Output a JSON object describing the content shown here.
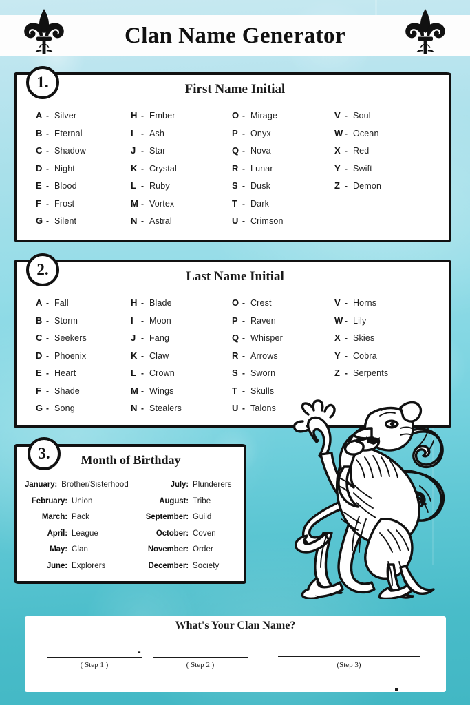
{
  "header": {
    "title": "Clan Name Generator",
    "ornament_left": "fleur-de-lis",
    "ornament_right": "fleur-de-lis"
  },
  "colors": {
    "background_top": "#c8e9f1",
    "background_bottom": "#42b7c4",
    "ink": "#111111",
    "paper": "#ffffff"
  },
  "sections": [
    {
      "number": "1.",
      "title": "First Name Initial",
      "columns": [
        {
          "entries": [
            {
              "key": "A",
              "value": "Silver"
            },
            {
              "key": "B",
              "value": "Eternal"
            },
            {
              "key": "C",
              "value": "Shadow"
            },
            {
              "key": "D",
              "value": "Night"
            },
            {
              "key": "E",
              "value": "Blood"
            },
            {
              "key": "F",
              "value": "Frost"
            },
            {
              "key": "G",
              "value": "Silent"
            }
          ]
        },
        {
          "entries": [
            {
              "key": "H",
              "value": "Ember"
            },
            {
              "key": "I",
              "value": "Ash"
            },
            {
              "key": "J",
              "value": "Star"
            },
            {
              "key": "K",
              "value": "Crystal"
            },
            {
              "key": "L",
              "value": "Ruby"
            },
            {
              "key": "M",
              "value": "Vortex"
            },
            {
              "key": "N",
              "value": "Astral"
            }
          ]
        },
        {
          "entries": [
            {
              "key": "O",
              "value": "Mirage"
            },
            {
              "key": "P",
              "value": "Onyx"
            },
            {
              "key": "Q",
              "value": "Nova"
            },
            {
              "key": "R",
              "value": "Lunar"
            },
            {
              "key": "S",
              "value": "Dusk"
            },
            {
              "key": "T",
              "value": "Dark"
            },
            {
              "key": "U",
              "value": "Crimson"
            }
          ]
        },
        {
          "entries": [
            {
              "key": "V",
              "value": "Soul"
            },
            {
              "key": "W",
              "value": "Ocean"
            },
            {
              "key": "X",
              "value": "Red"
            },
            {
              "key": "Y",
              "value": "Swift"
            },
            {
              "key": "Z",
              "value": "Demon"
            }
          ]
        }
      ]
    },
    {
      "number": "2.",
      "title": "Last Name Initial",
      "columns": [
        {
          "entries": [
            {
              "key": "A",
              "value": "Fall"
            },
            {
              "key": "B",
              "value": "Storm"
            },
            {
              "key": "C",
              "value": "Seekers"
            },
            {
              "key": "D",
              "value": "Phoenix"
            },
            {
              "key": "E",
              "value": "Heart"
            },
            {
              "key": "F",
              "value": "Shade"
            },
            {
              "key": "G",
              "value": "Song"
            }
          ]
        },
        {
          "entries": [
            {
              "key": "H",
              "value": "Blade"
            },
            {
              "key": "I",
              "value": "Moon"
            },
            {
              "key": "J",
              "value": "Fang"
            },
            {
              "key": "K",
              "value": "Claw"
            },
            {
              "key": "L",
              "value": "Crown"
            },
            {
              "key": "M",
              "value": "Wings"
            },
            {
              "key": "N",
              "value": "Stealers"
            }
          ]
        },
        {
          "entries": [
            {
              "key": "O",
              "value": "Crest"
            },
            {
              "key": "P",
              "value": "Raven"
            },
            {
              "key": "Q",
              "value": "Whisper"
            },
            {
              "key": "R",
              "value": "Arrows"
            },
            {
              "key": "S",
              "value": "Sworn"
            },
            {
              "key": "T",
              "value": "Skulls"
            },
            {
              "key": "U",
              "value": "Talons"
            }
          ]
        },
        {
          "entries": [
            {
              "key": "V",
              "value": "Horns"
            },
            {
              "key": "W",
              "value": "Lily"
            },
            {
              "key": "X",
              "value": "Skies"
            },
            {
              "key": "Y",
              "value": "Cobra"
            },
            {
              "key": "Z",
              "value": "Serpents"
            }
          ]
        }
      ]
    }
  ],
  "month_section": {
    "number": "3.",
    "title": "Month of Birthday",
    "columns": [
      {
        "entries": [
          {
            "key": "January:",
            "value": "Brother/Sisterhood"
          },
          {
            "key": "February:",
            "value": "Union"
          },
          {
            "key": "March:",
            "value": "Pack"
          },
          {
            "key": "April:",
            "value": "League"
          },
          {
            "key": "May:",
            "value": "Clan"
          },
          {
            "key": "June:",
            "value": "Explorers"
          }
        ]
      },
      {
        "entries": [
          {
            "key": "July:",
            "value": "Plunderers"
          },
          {
            "key": "August:",
            "value": "Tribe"
          },
          {
            "key": "September:",
            "value": "Guild"
          },
          {
            "key": "October:",
            "value": "Coven"
          },
          {
            "key": "November:",
            "value": "Order"
          },
          {
            "key": "December:",
            "value": "Society"
          }
        ]
      }
    ]
  },
  "answer_box": {
    "title": "What's Your Clan Name?",
    "separator": "-",
    "fields": [
      {
        "label": "( Step 1 )",
        "value": ""
      },
      {
        "label": "( Step 2 )",
        "value": ""
      },
      {
        "label": "(Step 3)",
        "value": ""
      }
    ]
  },
  "illustration": {
    "name": "heraldic-rampant-lion"
  }
}
